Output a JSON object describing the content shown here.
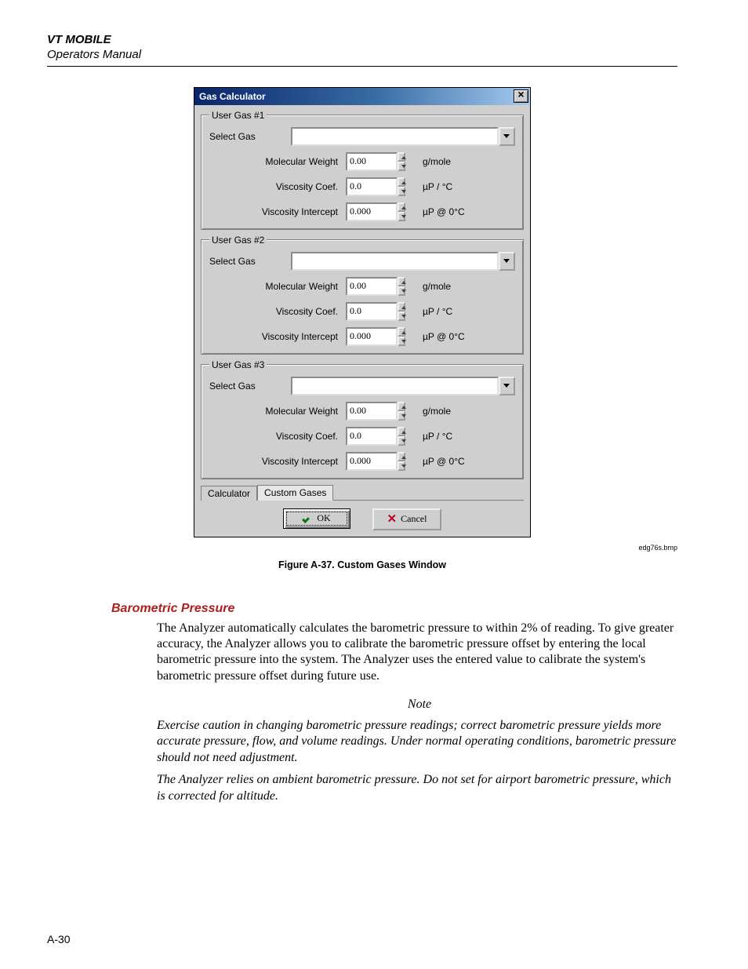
{
  "header": {
    "line1": "VT MOBILE",
    "line2": "Operators Manual"
  },
  "dialog": {
    "title": "Gas Calculator",
    "gases": [
      {
        "legend": "User Gas #1",
        "select_label": "Select Gas",
        "params": [
          {
            "label": "Molecular  Weight",
            "value": "0.00",
            "unit": "g/mole"
          },
          {
            "label": "Viscosity Coef.",
            "value": "0.0",
            "unit": "µP / °C"
          },
          {
            "label": "Viscosity Intercept",
            "value": "0.000",
            "unit": "µP @ 0°C"
          }
        ]
      },
      {
        "legend": "User Gas #2",
        "select_label": "Select Gas",
        "params": [
          {
            "label": "Molecular  Weight",
            "value": "0.00",
            "unit": "g/mole"
          },
          {
            "label": "Viscosity Coef.",
            "value": "0.0",
            "unit": "µP / °C"
          },
          {
            "label": "Viscosity Intercept",
            "value": "0.000",
            "unit": "µP @ 0°C"
          }
        ]
      },
      {
        "legend": "User Gas #3",
        "select_label": "Select Gas",
        "params": [
          {
            "label": "Molecular  Weight",
            "value": "0.00",
            "unit": "g/mole"
          },
          {
            "label": "Viscosity Coef.",
            "value": "0.0",
            "unit": "µP / °C"
          },
          {
            "label": "Viscosity Intercept",
            "value": "0.000",
            "unit": "µP @ 0°C"
          }
        ]
      }
    ],
    "tabs": {
      "calculator": "Calculator",
      "custom": "Custom Gases"
    },
    "buttons": {
      "ok": "OK",
      "cancel": "Cancel"
    }
  },
  "filename": "edg76s.bmp",
  "figure_caption": "Figure A-37. Custom Gases Window",
  "section_heading": "Barometric Pressure",
  "body_paragraph": "The Analyzer automatically calculates the barometric pressure to within 2% of reading. To give greater accuracy, the Analyzer allows you to calibrate the barometric pressure offset by entering the local barometric pressure into the system. The Analyzer uses the entered value to calibrate the system's barometric pressure offset during future use.",
  "note_heading": "Note",
  "note_p1": "Exercise caution in changing barometric pressure readings; correct barometric pressure yields more accurate pressure, flow, and volume readings. Under normal operating conditions, barometric pressure should not need adjustment.",
  "note_p2": "The Analyzer relies on ambient barometric pressure. Do not set for airport barometric pressure, which is corrected for altitude.",
  "page_number": "A-30"
}
